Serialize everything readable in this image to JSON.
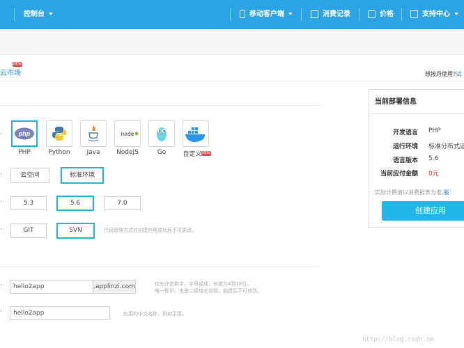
{
  "topbar": {
    "console": "控制台",
    "mobile_client": "移动客户端",
    "billing": "消费记录",
    "price": "价格",
    "support": "支持中心"
  },
  "header": {
    "crumb_text": "云市场",
    "crumb_badge": "NEW",
    "try_text": "想按月使用?",
    "try_link": "试"
  },
  "languages": [
    {
      "label": "PHP",
      "icon": "php-icon"
    },
    {
      "label": "Python",
      "icon": "python-icon"
    },
    {
      "label": "Java",
      "icon": "java-icon"
    },
    {
      "label": "NodeJS",
      "icon": "nodejs-icon"
    },
    {
      "label": "Go",
      "icon": "go-icon"
    },
    {
      "label": "自定义",
      "icon": "docker-icon",
      "badge": "NEW"
    }
  ],
  "environment": {
    "options": [
      "云空间",
      "标准环境"
    ],
    "selected": "标准环境"
  },
  "version": {
    "options": [
      "5.3",
      "5.6",
      "7.0"
    ],
    "selected": "5.6"
  },
  "vcs": {
    "options": [
      "GIT",
      "SVN"
    ],
    "selected": "SVN",
    "hint": "代码管理方式在创建应用成功后不可更改。"
  },
  "app_domain": {
    "value": "hello2app",
    "suffix": ".applinzi.com",
    "hint_line1": "仅允许由数字、字母组成，长度为4到18位。",
    "hint_line2": "唯一标识，也是二级域名前缀，创建后不可修改。"
  },
  "app_name": {
    "value": "hello2app",
    "hint": "应用的中文名称，例如示用。"
  },
  "deploy_panel": {
    "title": "当前部署信息",
    "rows": [
      {
        "key": "开发语言",
        "value": "PHP"
      },
      {
        "key": "运行环境",
        "value": "标准分布式运"
      },
      {
        "key": "语言版本",
        "value": "5.6"
      },
      {
        "key": "当前应付金额",
        "value": "0元"
      }
    ],
    "note": "实际计费请以消费报表为准,",
    "note_link": "服",
    "create_button": "创建应用",
    "price_color": "#e0302f"
  },
  "watermark": "http://blog.csdn.ne"
}
